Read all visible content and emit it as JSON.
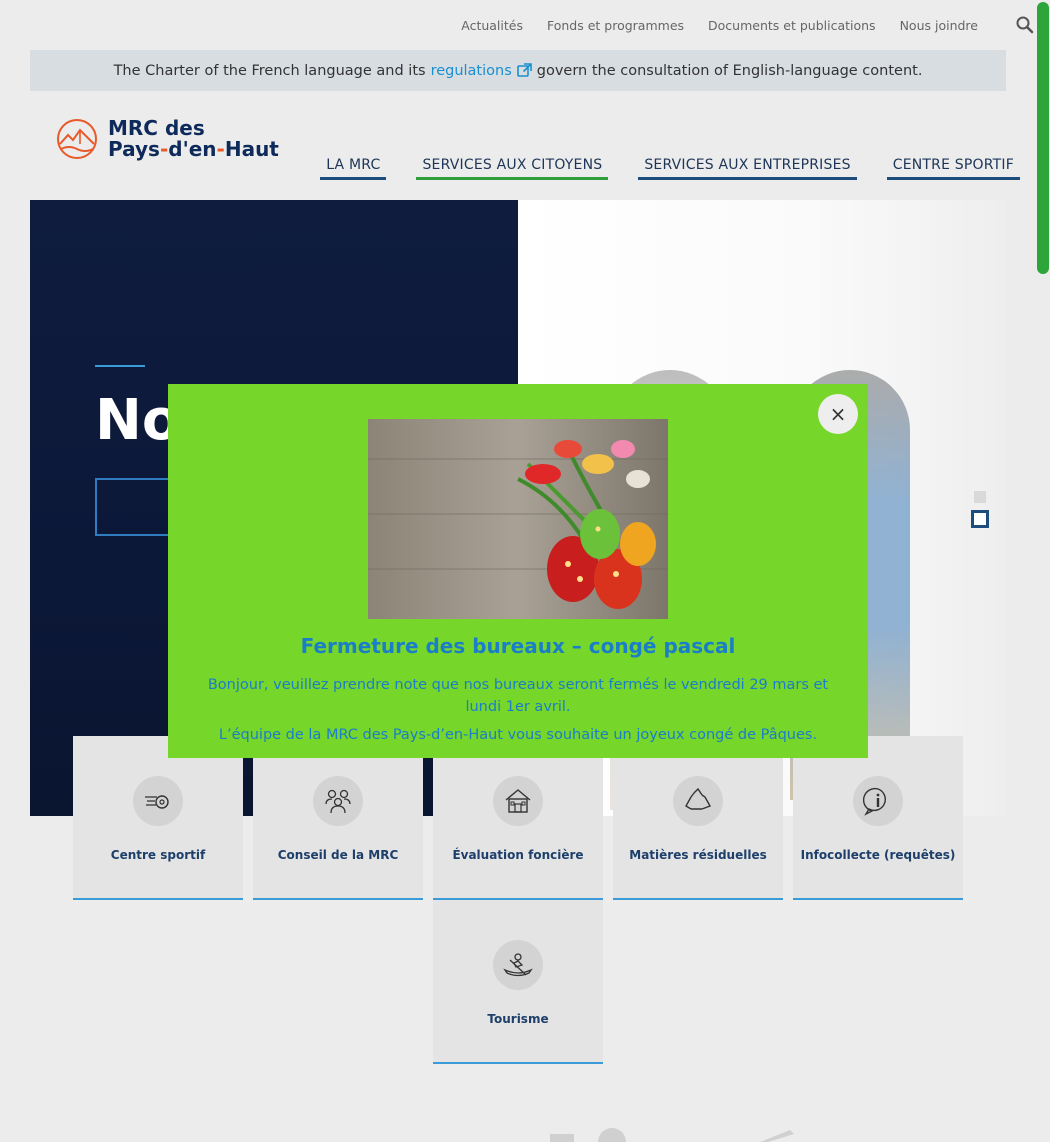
{
  "topbar": {
    "links": [
      "Actualités",
      "Fonds et programmes",
      "Documents et publications",
      "Nous joindre"
    ],
    "search_icon": "search-icon"
  },
  "charter": {
    "before": "The Charter of the French language and its",
    "link": "regulations",
    "after": "govern the consultation of English-language content.",
    "link_icon": "external-link-icon"
  },
  "logo": {
    "line1": "MRC des",
    "line2a": "Pays",
    "dash1": "-",
    "line2b": "d'en",
    "dash2": "-",
    "line2c": "Haut"
  },
  "nav": {
    "items": [
      "LA MRC",
      "SERVICES AUX CITOYENS",
      "SERVICES AUX ENTREPRISES",
      "CENTRE SPORTIF"
    ]
  },
  "hero": {
    "title": "No"
  },
  "tiles": [
    {
      "label": "Centre sportif",
      "icon": "whistle-icon"
    },
    {
      "label": "Conseil de la MRC",
      "icon": "group-icon"
    },
    {
      "label": "Évaluation foncière",
      "icon": "house-icon"
    },
    {
      "label": "Matières résiduelles",
      "icon": "recycle-icon"
    },
    {
      "label": "Infocollecte (requêtes)",
      "icon": "info-icon"
    },
    {
      "label": "Tourisme",
      "icon": "canoe-icon"
    }
  ],
  "modal": {
    "close": "×",
    "heading": "Fermeture des bureaux – congé pascal",
    "p1": "Bonjour, veuillez prendre note que nos bureaux seront fermés le vendredi 29 mars et lundi 1er avril.",
    "p2": "L’équipe de la MRC des Pays-d’en-Haut vous souhaite un joyeux congé de Pâques.",
    "image": "easter-eggs-tulips-image"
  },
  "colors": {
    "navy": "#0f1c3e",
    "accent_blue": "#1a7ec8",
    "accent_green": "#2e9d3a",
    "modal_green": "#76d62a",
    "logo_orange": "#e85a2a"
  }
}
